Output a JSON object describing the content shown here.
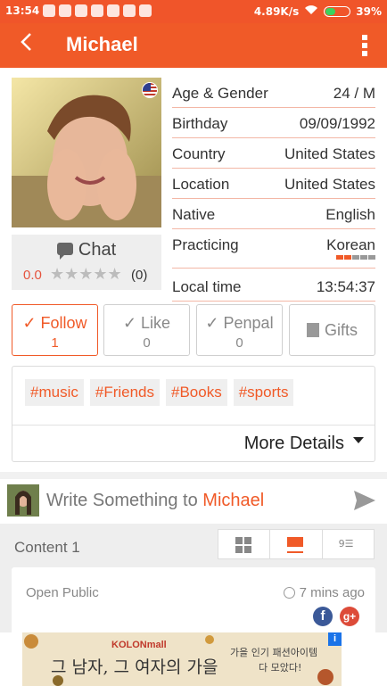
{
  "status_bar": {
    "time": "13:54",
    "speed": "4.89K/s",
    "battery": "39%"
  },
  "app_bar": {
    "title": "Michael"
  },
  "profile": {
    "chat_label": "Chat",
    "rating": "0.0",
    "rating_count": "(0)",
    "info": [
      {
        "label": "Age & Gender",
        "value": "24 / M"
      },
      {
        "label": "Birthday",
        "value": "09/09/1992"
      },
      {
        "label": "Country",
        "value": "United States"
      },
      {
        "label": "Location",
        "value": "United States"
      },
      {
        "label": "Native",
        "value": "English"
      },
      {
        "label": "Practicing",
        "value": "Korean"
      },
      {
        "label": "Local time",
        "value": "13:54:37"
      }
    ],
    "practicing_level": 0.4
  },
  "actions": {
    "follow": {
      "label": "Follow",
      "count": "1"
    },
    "like": {
      "label": "Like",
      "count": "0"
    },
    "penpal": {
      "label": "Penpal",
      "count": "0"
    },
    "gifts": {
      "label": "Gifts"
    }
  },
  "tags": [
    "#music",
    "#Friends",
    "#Books",
    "#sports"
  ],
  "more_details": "More Details",
  "composer": {
    "prompt": "Write Something to",
    "name": "Michael"
  },
  "content": {
    "label": "Content 1",
    "post": {
      "visibility": "Open Public",
      "time": "7 mins ago"
    }
  },
  "ad": {
    "brand": "KOLONmall",
    "headline": "그 남자, 그 여자의 가을",
    "copy_line1": "가을 인기 패션아이템",
    "copy_line2": "다 모았다!"
  },
  "colors": {
    "accent": "#f05a28"
  }
}
